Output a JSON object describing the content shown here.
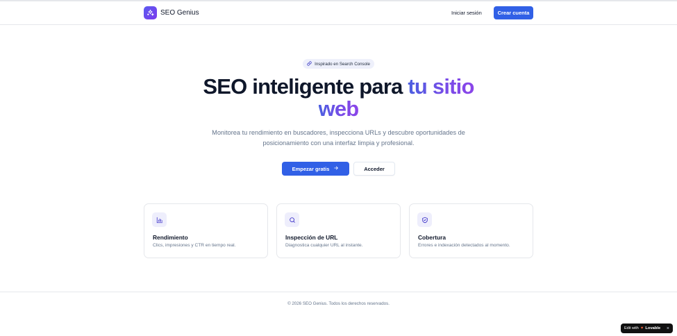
{
  "header": {
    "brand_name": "SEO Genius",
    "login_label": "Iniciar sesión",
    "signup_label": "Crear cuenta"
  },
  "hero": {
    "pill_label": "Inspirado en Search Console",
    "title_part1": "SEO inteligente para ",
    "title_highlight_1": "tu sitio",
    "title_highlight_2": "web",
    "subtitle": "Monitorea tu rendimiento en buscadores, inspecciona URLs y descubre oportunidades de posicionamiento con una interfaz limpia y profesional.",
    "primary_cta": "Empezar gratis",
    "secondary_cta": "Acceder"
  },
  "features": [
    {
      "icon": "bar-chart-icon",
      "title": "Rendimiento",
      "description": "Clics, impresiones y CTR en tiempo real."
    },
    {
      "icon": "search-icon",
      "title": "Inspección de URL",
      "description": "Diagnostica cualquier URL al instante."
    },
    {
      "icon": "shield-check-icon",
      "title": "Cobertura",
      "description": "Errores e indexación detectados al momento."
    }
  ],
  "footer": {
    "copyright": "© 2026 SEO Genius. Todos los derechos reservados."
  },
  "badge": {
    "prefix": "Edit with",
    "brand": "Lovable"
  },
  "colors": {
    "primary": "#3160e6",
    "accent_gradient_start": "#4b5fe0",
    "accent_gradient_end": "#8b45e9",
    "text": "#0f172a",
    "muted": "#64748b"
  }
}
